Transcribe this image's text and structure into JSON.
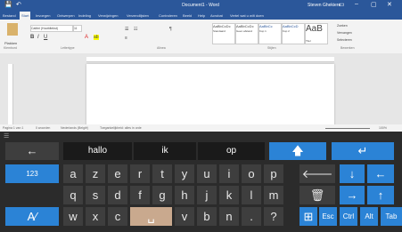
{
  "window": {
    "title": "Document1 - Word",
    "user": "Steven Ghekiere",
    "controls": [
      "▭",
      "–",
      "▢",
      "✕"
    ]
  },
  "ribbon_tabs": [
    "Bestand",
    "Start",
    "Invoegen",
    "Ontwerpen",
    "Indeling",
    "Verwijzingen",
    "Verzendlijsten",
    "Controleren",
    "Beeld",
    "Help",
    "Acrobat",
    "Vertel wat u wilt doen"
  ],
  "ribbon": {
    "paste_label": "Plakken",
    "font_name": "Calibri (Hoofdtekst)",
    "font_size": "11",
    "style_normal": "AaBbCcDc",
    "style_nospacing": "AaBbCcDc",
    "style_h1": "AaBbCc",
    "style_h2": "AaBbCcD",
    "style_title": "AaB",
    "style_labels": [
      "Standaard",
      "Geen afstand",
      "Kop 1",
      "Kop 2",
      "Titel"
    ],
    "group_labels": [
      "Klembord",
      "Lettertype",
      "Alinea",
      "Stijlen",
      "Bewerken"
    ],
    "find": "Zoeken",
    "replace": "Vervangen",
    "select": "Selecteren"
  },
  "statusbar": {
    "page": "Pagina 1 van 1",
    "words": "0 woorden",
    "language": "Nederlands (België)",
    "accessibility": "Toegankelijkheid: alles in orde",
    "zoom": "100%"
  },
  "keyboard": {
    "suggestions": [
      "hallo",
      "ik",
      "op"
    ],
    "row1_left": "123",
    "row1": [
      "a",
      "z",
      "e",
      "r",
      "t",
      "y",
      "u",
      "i",
      "o",
      "p"
    ],
    "row2": [
      "q",
      "s",
      "d",
      "f",
      "g",
      "h",
      "j",
      "k",
      "l",
      "m"
    ],
    "row3": [
      "w",
      "x",
      "c",
      "␣",
      "v",
      "b",
      "n",
      ".",
      "?"
    ],
    "fn_keys": [
      "Esc",
      "Ctrl",
      "Alt",
      "Tab"
    ]
  },
  "colors": {
    "word_blue": "#2b579a",
    "key_blue": "#2b83d6",
    "key_gray": "#3e3e3e",
    "kbd_bg": "#2b2b2b"
  }
}
